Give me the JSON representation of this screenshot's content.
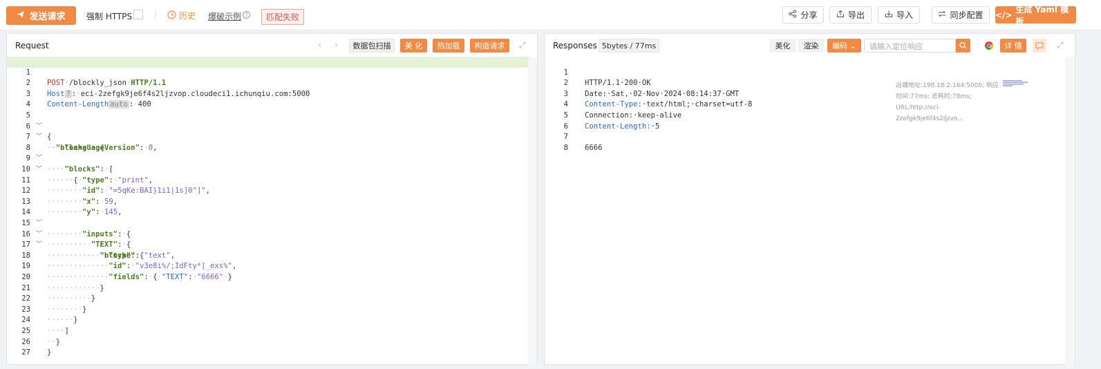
{
  "topbar": {
    "send_label": "发送请求",
    "https_label": "强制 HTTPS",
    "history_label": "历史",
    "example_label": "爆破示例",
    "mismatch_label": "匹配失败",
    "share_label": "分享",
    "export_label": "导出",
    "import_label": "导入",
    "sync_label": "同步配置",
    "yaml_label": "生成 Yaml 模板"
  },
  "request": {
    "title": "Request",
    "scan_label": "数据包扫描",
    "beautify_label": "美 化",
    "hotload_label": "热加载",
    "construct_label": "构造请求",
    "lines": [
      {
        "n": "1",
        "hl": true
      },
      {
        "n": "2"
      },
      {
        "n": "3"
      },
      {
        "n": "4"
      },
      {
        "n": "5"
      },
      {
        "n": "6",
        "fold": true
      },
      {
        "n": "7"
      },
      {
        "n": "8",
        "fold": true
      },
      {
        "n": "9",
        "fold": true
      },
      {
        "n": "10"
      },
      {
        "n": "11"
      },
      {
        "n": "12"
      },
      {
        "n": "13"
      },
      {
        "n": "14",
        "fold": true
      },
      {
        "n": "15",
        "fold": true
      },
      {
        "n": "16",
        "fold": true
      },
      {
        "n": "17"
      },
      {
        "n": "18"
      },
      {
        "n": "19"
      },
      {
        "n": "20"
      },
      {
        "n": "21"
      },
      {
        "n": "22"
      },
      {
        "n": "23"
      },
      {
        "n": "24"
      },
      {
        "n": "25"
      },
      {
        "n": "26"
      },
      {
        "n": "27"
      }
    ],
    "text": {
      "method": "POST",
      "path": "/blockly_json",
      "proto": "HTTP/1.1",
      "host_key": "Host",
      "host_badge": "?",
      "host_val": "eci-2zefgk9je6f4s2ljzvop.cloudeci1.ichunqiu.com:5000",
      "cl_key": "Content-Length",
      "cl_badge": "auto",
      "cl_val": "400",
      "k_blocks": "\"blocks\"",
      "k_langver": "\"languageVersion\"",
      "v_langver": "0",
      "k_type": "\"type\"",
      "v_print": "\"print\"",
      "k_id": "\"id\"",
      "v_id1": "\"=5qKe:BAI}1i1|1s]0^]\"",
      "k_x": "\"x\"",
      "v_x": "59",
      "k_y": "\"y\"",
      "v_y": "145",
      "k_inputs": "\"inputs\"",
      "k_TEXT": "\"TEXT\"",
      "k_block": "\"block\"",
      "v_text": "\"text\"",
      "v_id2": "\"v3e8i%/;IdFty*[_exs%\"",
      "k_fields": "\"fields\"",
      "v_6666": "\"6666\""
    }
  },
  "response": {
    "title": "Responses",
    "size_badge": "5bytes / 77ms",
    "beautify_label": "美化",
    "render_label": "渲染",
    "encode_label": "编码",
    "search_placeholder": "请输入定位响应",
    "details_label": "详 情",
    "meta_text": "远端地址:198.18.2.164:5000; 响应时间:77ms; 总耗时:78ms; URL:http://eci-2zefgk9je6f4s2ljzvo...",
    "lines": [
      {
        "n": "1",
        "a": "HTTP/1.1·200·OK"
      },
      {
        "n": "2",
        "a": "Date:·Sat,·02·Nov·2024·08:14:37·GMT"
      },
      {
        "n": "3",
        "k": "Content-Type:",
        "a": "·text/html;·charset=utf-8"
      },
      {
        "n": "4",
        "a": "Connection:·keep-alive"
      },
      {
        "n": "5",
        "k": "Content-Length:",
        "a": "·5"
      },
      {
        "n": "6",
        "a": ""
      },
      {
        "n": "7",
        "a": "6666"
      },
      {
        "n": "8",
        "a": ""
      }
    ]
  },
  "colors": {
    "accent": "#f08a45",
    "highlight": "#e7f0d9",
    "key": "#4c7a1f",
    "string": "#7c5fd0",
    "header": "#2a68c8"
  }
}
